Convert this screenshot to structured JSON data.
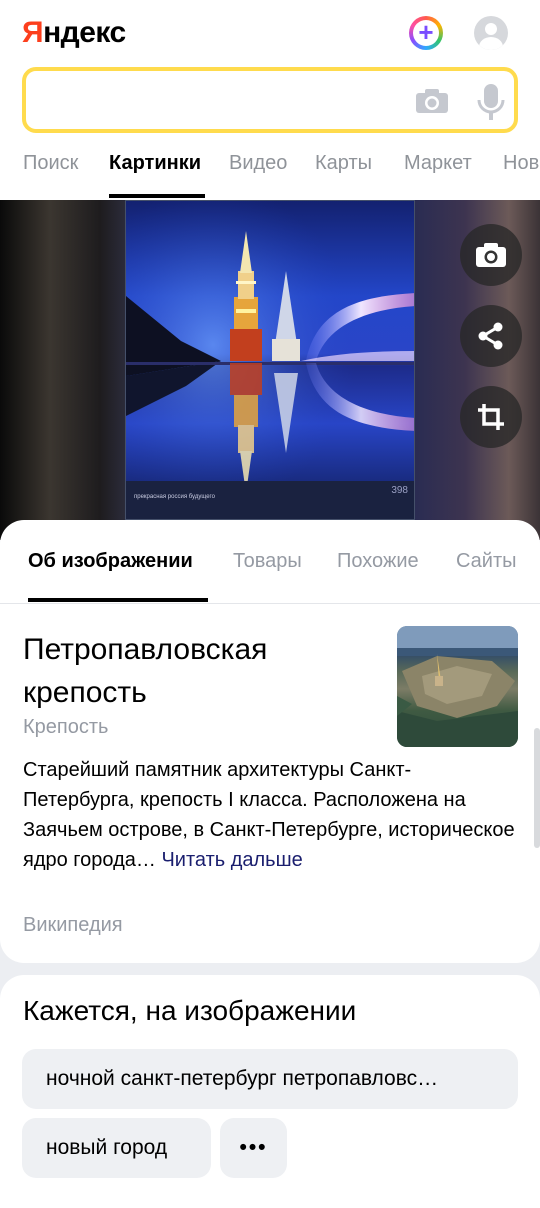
{
  "header": {
    "logo_text": "Яндекс",
    "search": {
      "value": "",
      "placeholder": ""
    },
    "tabs": [
      {
        "label": "Поиск",
        "active": false
      },
      {
        "label": "Картинки",
        "active": true
      },
      {
        "label": "Видео",
        "active": false
      },
      {
        "label": "Карты",
        "active": false
      },
      {
        "label": "Маркет",
        "active": false
      },
      {
        "label": "Нов",
        "active": false
      }
    ]
  },
  "viewer": {
    "caption": "прекрасная россия будущего",
    "number": "398",
    "actions": [
      "camera-icon",
      "share-icon",
      "crop-icon"
    ]
  },
  "info": {
    "tabs": [
      {
        "label": "Об изображении",
        "active": true
      },
      {
        "label": "Товары",
        "active": false
      },
      {
        "label": "Похожие",
        "active": false
      },
      {
        "label": "Сайты",
        "active": false
      }
    ],
    "title": "Петропавловская крепость",
    "subtitle": "Крепость",
    "description": "Старейший памятник архитектуры Санкт-Петербурга, крепость I класса. Расположена на Заячьем острове, в Санкт-Петербурге, историческое ядро города…",
    "read_more": "Читать дальше",
    "source": "Википедия"
  },
  "seems": {
    "title": "Кажется, на изображении",
    "chips": [
      "ночной санкт-петербург петропавловс…",
      "новый город"
    ],
    "more": "•••"
  },
  "colors": {
    "accent_yellow": "#ffdb4d",
    "logo_red": "#fc3f1d",
    "muted_text": "#959aa3",
    "link": "#1a1e6e"
  }
}
